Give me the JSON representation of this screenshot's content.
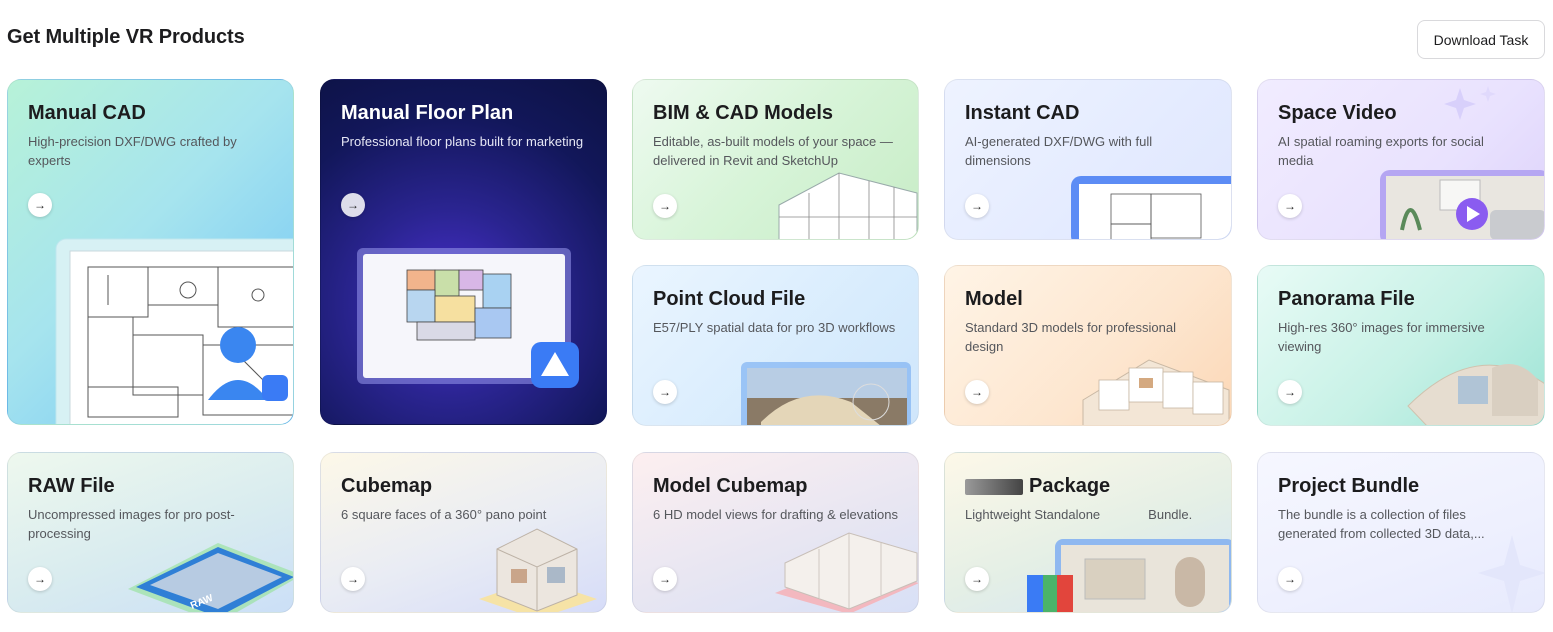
{
  "header": {
    "title": "Get Multiple VR Products",
    "download_label": "Download Task"
  },
  "cards": {
    "manual_cad": {
      "title": "Manual CAD",
      "desc": "High-precision DXF/DWG crafted by experts"
    },
    "manual_floor_plan": {
      "title": "Manual Floor Plan",
      "desc": "Professional floor plans built for marketing"
    },
    "bim_cad": {
      "title": "BIM & CAD Models",
      "desc": "Editable, as-built models of your space — delivered in Revit and SketchUp"
    },
    "instant_cad": {
      "title": "Instant CAD",
      "desc": "AI-generated DXF/DWG with full dimensions"
    },
    "space_video": {
      "title": "Space Video",
      "desc": "AI spatial roaming exports for social media"
    },
    "point_cloud": {
      "title": "Point Cloud File",
      "desc": "E57/PLY spatial data for pro 3D workflows"
    },
    "model": {
      "title": "Model",
      "desc": "Standard 3D models for professional design"
    },
    "panorama": {
      "title": "Panorama File",
      "desc": "High-res 360° images for immersive viewing"
    },
    "raw_file": {
      "title": "RAW File",
      "desc": "Uncompressed images for pro post-processing",
      "badge": "RAW"
    },
    "cubemap": {
      "title": "Cubemap",
      "desc": "6 square faces of a 360° pano point"
    },
    "model_cubemap": {
      "title": "Model Cubemap",
      "desc": "6 HD model views for drafting & elevations"
    },
    "package": {
      "title": "Package",
      "desc_a": "Lightweight Standalone",
      "desc_b": "Bundle."
    },
    "project_bundle": {
      "title": "Project Bundle",
      "desc": "The bundle is a collection of files generated from collected 3D data,..."
    }
  },
  "arrow_glyph": "→",
  "icons": [
    "arrow-right-icon",
    "play-icon",
    "drafting-tool-icon",
    "user-avatar-icon",
    "archive-icon",
    "sparkle-icon"
  ],
  "colors": {
    "floor_plan_bg": "#12175a",
    "accent_blue": "#3a7bf5",
    "accent_purple": "#8a5cf0"
  }
}
